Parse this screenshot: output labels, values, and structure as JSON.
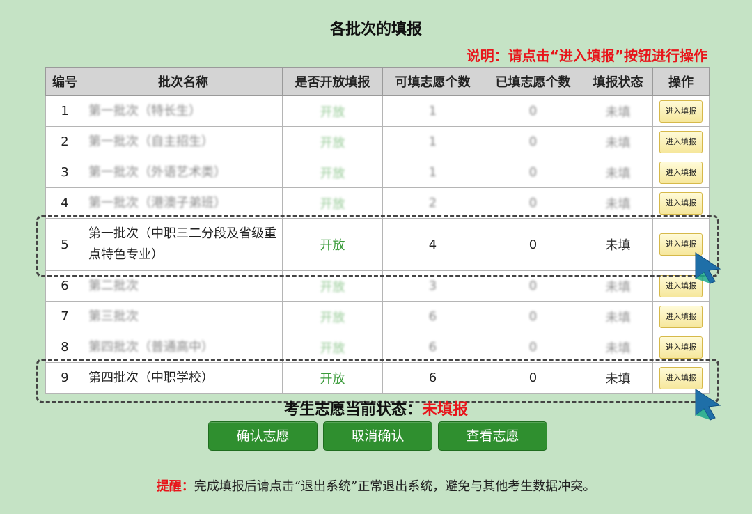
{
  "page": {
    "title": "各批次的填报",
    "note": "说明：请点击“进入填报”按钮进行操作"
  },
  "table": {
    "headers": [
      "编号",
      "批次名称",
      "是否开放填报",
      "可填志愿个数",
      "已填志愿个数",
      "填报状态",
      "操作"
    ],
    "rows": [
      {
        "no": "1",
        "name": "第一批次（特长生）",
        "open": "开放",
        "allowed": "1",
        "filled": "0",
        "status": "未填",
        "action": "进入填报"
      },
      {
        "no": "2",
        "name": "第一批次（自主招生）",
        "open": "开放",
        "allowed": "1",
        "filled": "0",
        "status": "未填",
        "action": "进入填报"
      },
      {
        "no": "3",
        "name": "第一批次（外语艺术类）",
        "open": "开放",
        "allowed": "1",
        "filled": "0",
        "status": "未填",
        "action": "进入填报"
      },
      {
        "no": "4",
        "name": "第一批次（港澳子弟班）",
        "open": "开放",
        "allowed": "2",
        "filled": "0",
        "status": "未填",
        "action": "进入填报"
      },
      {
        "no": "5",
        "name": "第一批次（中职三二分段及省级重点特色专业）",
        "open": "开放",
        "allowed": "4",
        "filled": "0",
        "status": "未填",
        "action": "进入填报"
      },
      {
        "no": "6",
        "name": "第二批次",
        "open": "开放",
        "allowed": "3",
        "filled": "0",
        "status": "未填",
        "action": "进入填报"
      },
      {
        "no": "7",
        "name": "第三批次",
        "open": "开放",
        "allowed": "6",
        "filled": "0",
        "status": "未填",
        "action": "进入填报"
      },
      {
        "no": "8",
        "name": "第四批次（普通高中）",
        "open": "开放",
        "allowed": "6",
        "filled": "0",
        "status": "未填",
        "action": "进入填报"
      },
      {
        "no": "9",
        "name": "第四批次（中职学校）",
        "open": "开放",
        "allowed": "6",
        "filled": "0",
        "status": "未填",
        "action": "进入填报"
      }
    ]
  },
  "state": {
    "label": "考生志愿当前状态：",
    "value": "未填报"
  },
  "buttons": {
    "confirm": "确认志愿",
    "cancel": "取消确认",
    "view": "查看志愿"
  },
  "reminder": {
    "label": "提醒：",
    "text": "完成填报后请点击“退出系统”正常退出系统，避免与其他考生数据冲突。"
  },
  "colors": {
    "background": "#c5e3c5",
    "accent_red": "#e8141a",
    "button_green": "#2f8f2f",
    "open_text_green": "#3b9b3b",
    "cursor_blue": "#1f6fa8"
  },
  "icons": {
    "pointer": "cursor-arrow-icon"
  }
}
